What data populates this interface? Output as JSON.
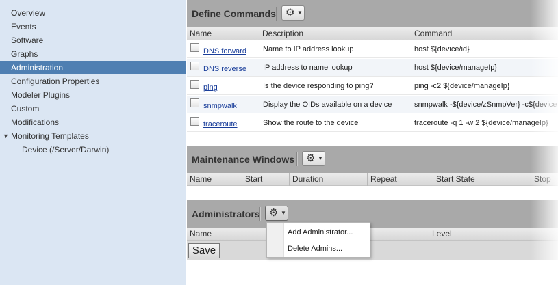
{
  "sidebar": {
    "items": [
      {
        "label": "Overview"
      },
      {
        "label": "Events"
      },
      {
        "label": "Software"
      },
      {
        "label": "Graphs"
      },
      {
        "label": "Administration",
        "active": true
      },
      {
        "label": "Configuration Properties"
      },
      {
        "label": "Modeler Plugins"
      },
      {
        "label": "Custom"
      },
      {
        "label": "Modifications"
      },
      {
        "label": "Monitoring Templates"
      },
      {
        "label": "Device (/Server/Darwin)"
      }
    ]
  },
  "commands": {
    "title": "Define Commands",
    "columns": [
      "Name",
      "Description",
      "Command"
    ],
    "rows": [
      {
        "name": "DNS forward",
        "description": "Name to IP address lookup",
        "command": "host ${device/id}"
      },
      {
        "name": "DNS reverse",
        "description": "IP address to name lookup",
        "command": "host ${device/manageIp}"
      },
      {
        "name": "ping",
        "description": "Is the device responding to ping?",
        "command": "ping -c2 ${device/manageIp}"
      },
      {
        "name": "snmpwalk",
        "description": "Display the OIDs available on a device",
        "command": "snmpwalk -${device/zSnmpVer} -c${device"
      },
      {
        "name": "traceroute",
        "description": "Show the route to the device",
        "command": "traceroute -q 1 -w 2 ${device/manageIp}"
      }
    ]
  },
  "maintenance": {
    "title": "Maintenance Windows",
    "columns": [
      "Name",
      "Start",
      "Duration",
      "Repeat",
      "Start State",
      "Stop"
    ]
  },
  "administrators": {
    "title": "Administrators",
    "columns": [
      "Name",
      "Level"
    ]
  },
  "menu": {
    "items": [
      "Add Administrator...",
      "Delete Admins..."
    ]
  },
  "save_label": "Save",
  "icons": {
    "gear": "gear-icon",
    "caret": "caret-down-icon",
    "expand": "triangle-down-icon"
  },
  "colors": {
    "sidebar_bg": "#dbe6f3",
    "active_bg": "#4f7fb2",
    "panel_header": "#a9a9a9",
    "link": "#1a3e9a"
  }
}
